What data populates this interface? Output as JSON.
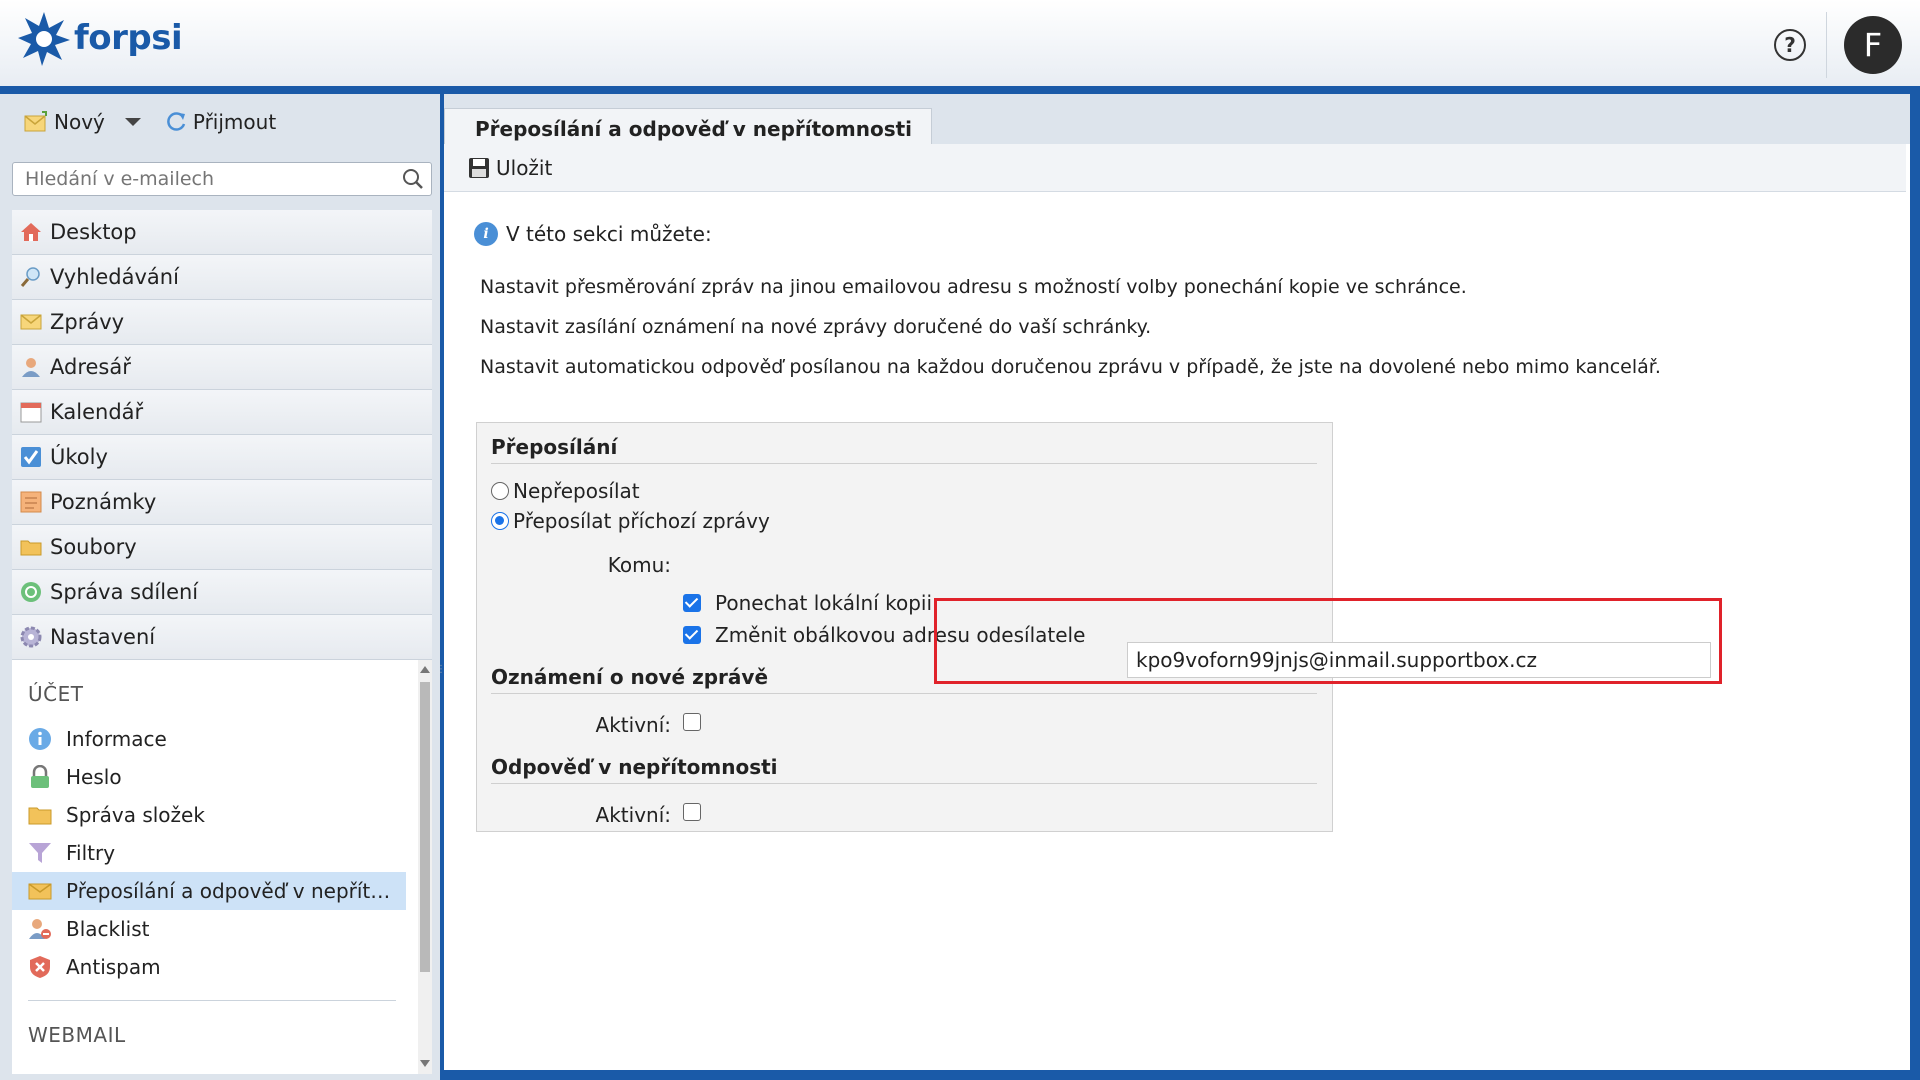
{
  "header": {
    "logo_text": "forpsi",
    "help_label": "?",
    "avatar_letter": "F"
  },
  "toolbar": {
    "new_label": "Nový",
    "receive_label": "Přijmout"
  },
  "search": {
    "placeholder": "Hledání v e-mailech"
  },
  "nav": {
    "items": [
      {
        "label": "Desktop",
        "icon": "home-icon"
      },
      {
        "label": "Vyhledávání",
        "icon": "search-icon"
      },
      {
        "label": "Zprávy",
        "icon": "envelope-icon"
      },
      {
        "label": "Adresář",
        "icon": "contacts-icon"
      },
      {
        "label": "Kalendář",
        "icon": "calendar-icon"
      },
      {
        "label": "Úkoly",
        "icon": "checkbox-icon"
      },
      {
        "label": "Poznámky",
        "icon": "note-icon"
      },
      {
        "label": "Soubory",
        "icon": "folder-icon"
      },
      {
        "label": "Správa sdílení",
        "icon": "share-icon"
      },
      {
        "label": "Nastavení",
        "icon": "gear-icon"
      }
    ]
  },
  "settings": {
    "account_heading": "ÚČET",
    "items": [
      {
        "label": "Informace",
        "icon": "info-icon"
      },
      {
        "label": "Heslo",
        "icon": "lock-icon"
      },
      {
        "label": "Správa složek",
        "icon": "folder-icon"
      },
      {
        "label": "Filtry",
        "icon": "filter-icon"
      },
      {
        "label": "Přeposílání a odpověď v nepřít…",
        "icon": "forward-mail-icon",
        "active": true
      },
      {
        "label": "Blacklist",
        "icon": "blacklist-icon"
      },
      {
        "label": "Antispam",
        "icon": "shield-icon"
      }
    ],
    "webmail_heading": "WEBMAIL"
  },
  "main": {
    "tab_label": "Přeposílání a odpověď v nepřítomnosti",
    "save_label": "Uložit",
    "intro": "V této sekci můžete:",
    "paragraphs": [
      "Nastavit přesměrování zpráv na jinou emailovou adresu s možností volby ponechání kopie ve schránce.",
      "Nastavit zasílání oznámení na nové zprávy doručené do vaší schránky.",
      "Nastavit automatickou odpověď posílanou na každou doručenou zprávu v případě, že jste na dovolené nebo mimo kancelář."
    ]
  },
  "forwarding": {
    "title": "Přeposílání",
    "option_off": "Nepřeposílat",
    "option_on": "Přeposílat příchozí zprávy",
    "to_label": "Komu:",
    "to_value": "kpo9voforn99jnjs@inmail.supportbox.cz",
    "keep_copy_label": "Ponechat lokální kopii",
    "keep_copy_checked": true,
    "change_envelope_label": "Změnit obálkovou adresu odesílatele",
    "change_envelope_checked": true
  },
  "notification": {
    "title": "Oznámení o nové zprávě",
    "active_label": "Aktivní:",
    "active_checked": false
  },
  "autoreply": {
    "title": "Odpověď v nepřítomnosti",
    "active_label": "Aktivní:",
    "active_checked": false
  },
  "colors": {
    "brand": "#1a5aa8",
    "highlight_border": "#e0222a",
    "active_item": "#cde2f7",
    "checkbox": "#1a73e8"
  }
}
